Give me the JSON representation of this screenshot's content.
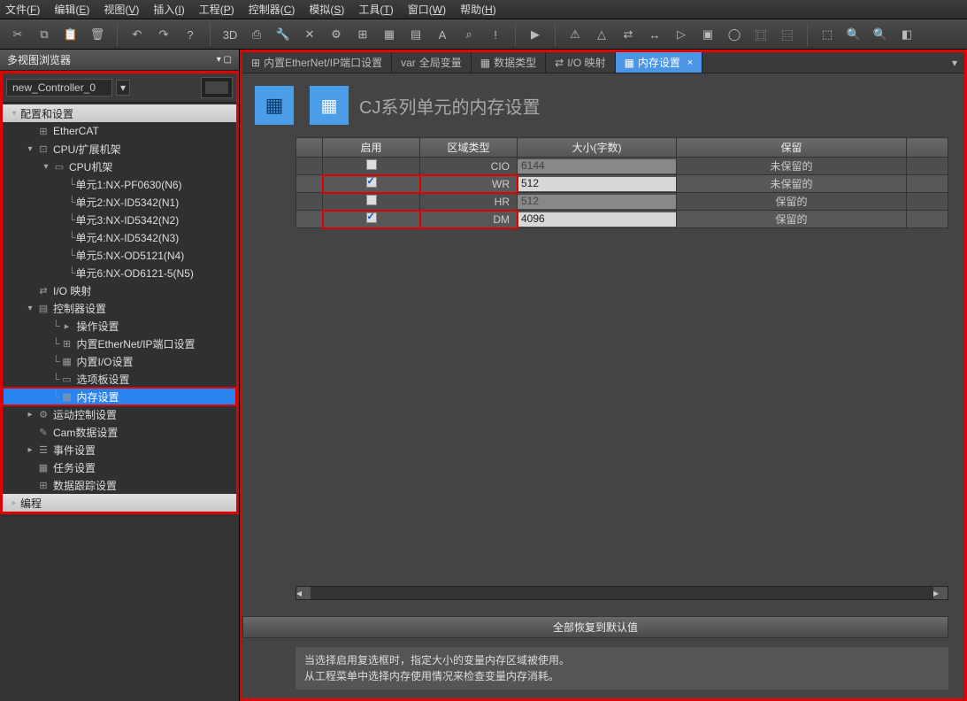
{
  "menu": [
    "文件(F)",
    "编辑(E)",
    "视图(V)",
    "插入(I)",
    "工程(P)",
    "控制器(C)",
    "模拟(S)",
    "工具(T)",
    "窗口(W)",
    "帮助(H)"
  ],
  "toolbar": {
    "g1": [
      "✂",
      "⧉",
      "📋",
      "🗑"
    ],
    "g2": [
      "↶",
      "↷",
      "?"
    ],
    "g3": [
      "3D",
      "⎙",
      "🔧",
      "✕",
      "⚙",
      "⊞",
      "▦",
      "▤",
      "A",
      "⌕",
      "!"
    ],
    "g4": [
      "▶"
    ],
    "g5": [
      "⚠",
      "△",
      "⇄",
      "↔",
      "▷",
      "▣",
      "◯",
      "⿴",
      "⿳"
    ],
    "g6": [
      "⬚",
      "🔍",
      "🔍",
      "◧"
    ]
  },
  "sidebar": {
    "title": "多视图浏览器",
    "controller": "new_Controller_0",
    "tree": [
      {
        "d": 0,
        "tw": "▾",
        "label": "配置和设置",
        "header": true
      },
      {
        "d": 1,
        "tw": "",
        "icon": "⊞",
        "label": "EtherCAT"
      },
      {
        "d": 1,
        "tw": "▾",
        "icon": "⊡",
        "label": "CPU/扩展机架"
      },
      {
        "d": 2,
        "tw": "▾",
        "icon": "▭",
        "label": "CPU机架"
      },
      {
        "d": 3,
        "tw": "",
        "pre": "└",
        "label": "单元1:NX-PF0630(N6)"
      },
      {
        "d": 3,
        "tw": "",
        "pre": "└",
        "label": "单元2:NX-ID5342(N1)"
      },
      {
        "d": 3,
        "tw": "",
        "pre": "└",
        "label": "单元3:NX-ID5342(N2)"
      },
      {
        "d": 3,
        "tw": "",
        "pre": "└",
        "label": "单元4:NX-ID5342(N3)"
      },
      {
        "d": 3,
        "tw": "",
        "pre": "└",
        "label": "单元5:NX-OD5121(N4)"
      },
      {
        "d": 3,
        "tw": "",
        "pre": "└",
        "label": "单元6:NX-OD6121-5(N5)"
      },
      {
        "d": 1,
        "tw": "",
        "icon": "⇄",
        "label": "I/O 映射"
      },
      {
        "d": 1,
        "tw": "▾",
        "icon": "▤",
        "label": "控制器设置"
      },
      {
        "d": 2,
        "tw": "",
        "pre": "└",
        "icon": "▸",
        "label": "操作设置"
      },
      {
        "d": 2,
        "tw": "",
        "pre": "└",
        "icon": "⊞",
        "label": "内置EtherNet/IP端口设置"
      },
      {
        "d": 2,
        "tw": "",
        "pre": "└",
        "icon": "▦",
        "label": "内置I/O设置"
      },
      {
        "d": 2,
        "tw": "",
        "pre": "└",
        "icon": "▭",
        "label": "选项板设置"
      },
      {
        "d": 2,
        "tw": "",
        "pre": "└",
        "icon": "▦",
        "label": "内存设置",
        "sel": true,
        "hl": true
      },
      {
        "d": 1,
        "tw": "▸",
        "icon": "⚙",
        "label": "运动控制设置"
      },
      {
        "d": 1,
        "tw": "",
        "icon": "✎",
        "label": "Cam数据设置"
      },
      {
        "d": 1,
        "tw": "▸",
        "icon": "☰",
        "label": "事件设置"
      },
      {
        "d": 1,
        "tw": "",
        "icon": "▦",
        "label": "任务设置"
      },
      {
        "d": 1,
        "tw": "",
        "icon": "⊞",
        "label": "数据跟踪设置"
      },
      {
        "d": 0,
        "tw": "▸",
        "label": "编程",
        "header": true
      }
    ]
  },
  "tabs": [
    {
      "icon": "⊞",
      "label": "内置EtherNet/IP端口设置"
    },
    {
      "icon": "var",
      "label": "全局变量"
    },
    {
      "icon": "▦",
      "label": "数据类型"
    },
    {
      "icon": "⇄",
      "label": "I/O 映射"
    },
    {
      "icon": "▦",
      "label": "内存设置",
      "active": true,
      "close": true
    }
  ],
  "content": {
    "title": "CJ系列单元的内存设置",
    "columns": [
      "",
      "启用",
      "区域类型",
      "大小(字数)",
      "保留",
      ""
    ],
    "rows": [
      {
        "on": false,
        "area": "CIO",
        "size": "6144",
        "sizeEditable": false,
        "retain": "未保留的",
        "hl": false
      },
      {
        "on": true,
        "area": "WR",
        "size": "512",
        "sizeEditable": true,
        "retain": "未保留的",
        "hl": true
      },
      {
        "on": false,
        "area": "HR",
        "size": "512",
        "sizeEditable": false,
        "retain": "保留的",
        "hl": false
      },
      {
        "on": true,
        "area": "DM",
        "size": "4096",
        "sizeEditable": true,
        "retain": "保留的",
        "hl": true
      }
    ],
    "restoreBtn": "全部恢复到默认值",
    "hint1": "当选择启用复选框时，指定大小的变量内存区域被使用。",
    "hint2": "从工程菜单中选择内存使用情况来检查变量内存消耗。"
  }
}
